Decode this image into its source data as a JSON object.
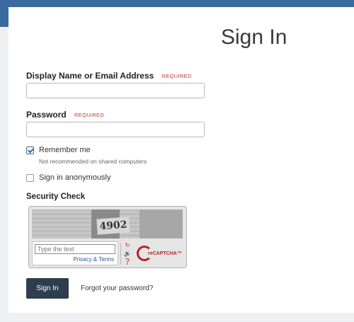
{
  "page": {
    "title": "Sign In"
  },
  "form": {
    "username_label": "Display Name or Email Address",
    "username_required": "REQUIRED",
    "username_value": "",
    "password_label": "Password",
    "password_required": "REQUIRED",
    "password_value": "",
    "remember_label": "Remember me",
    "remember_checked": true,
    "remember_hint": "Not recommended on shared computers",
    "anon_label": "Sign in anonymously",
    "anon_checked": false
  },
  "security": {
    "label": "Security Check",
    "captcha_image_text": "4902",
    "input_placeholder": "Type the text",
    "privacy_link": "Privacy & Terms",
    "logo_text": "reCAPTCHA™"
  },
  "actions": {
    "signin_label": "Sign In",
    "forgot_label": "Forgot your password?"
  },
  "colors": {
    "topbar": "#3b6aa0",
    "button": "#2e3e4f",
    "required": "#c0392b"
  }
}
